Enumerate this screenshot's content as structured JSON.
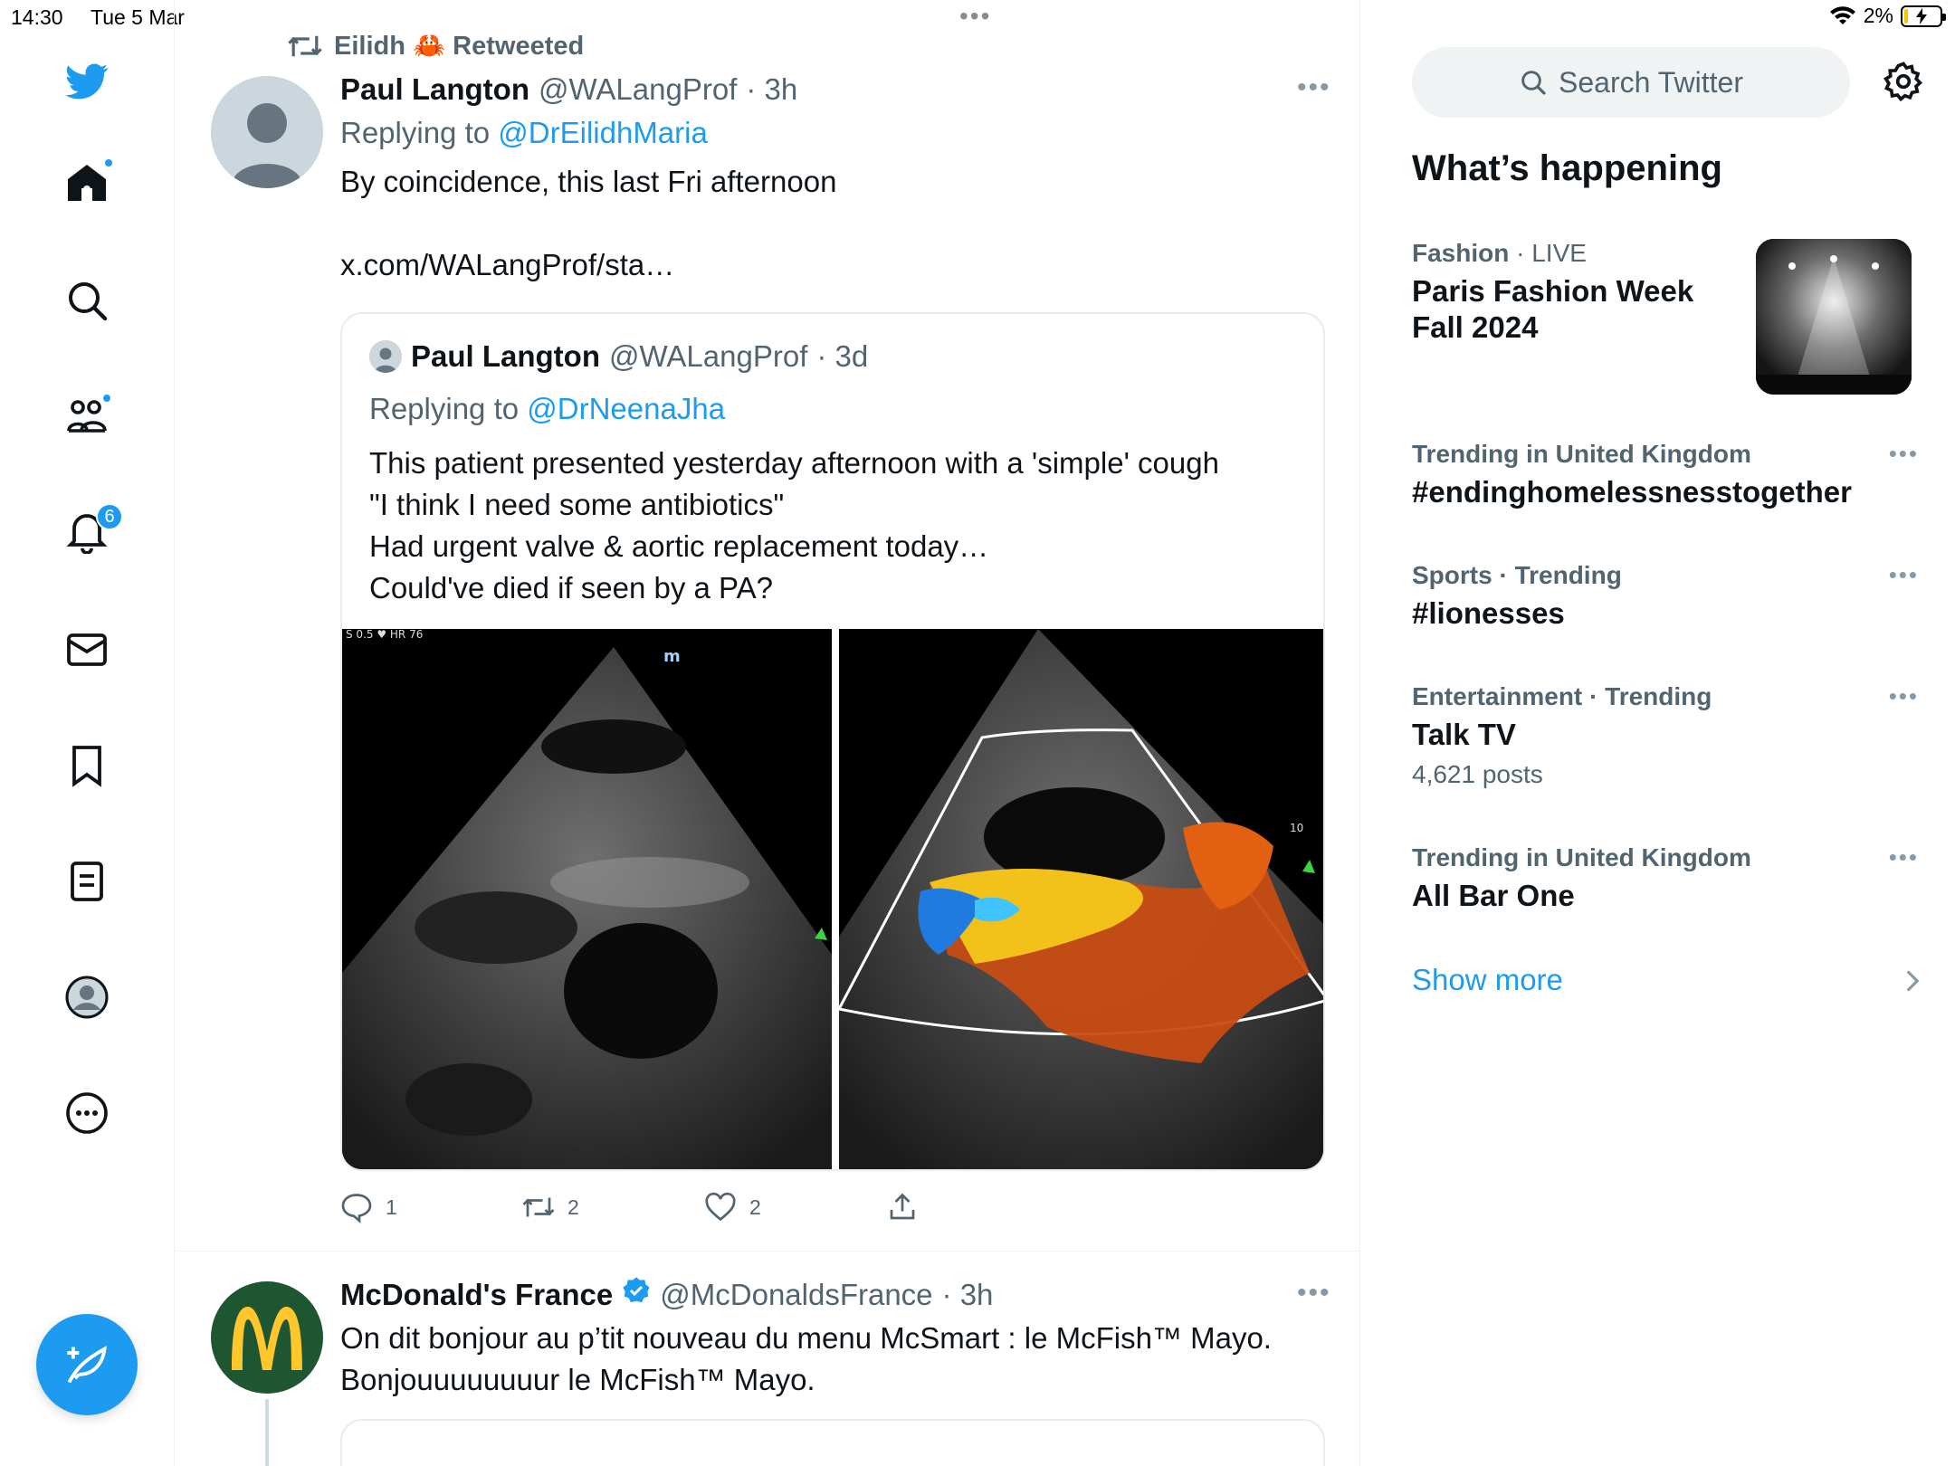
{
  "status_bar": {
    "time": "14:30",
    "date": "Tue 5 Mar",
    "multitask": "•••",
    "battery": "2%"
  },
  "nav": {
    "notifications_badge": "6",
    "items": [
      "home-icon",
      "search-icon",
      "communities-icon",
      "notifications-icon",
      "messages-icon",
      "bookmarks-icon",
      "lists-icon",
      "profile-icon",
      "more-icon"
    ]
  },
  "tweet1": {
    "retweeted_by": "Eilidh 🦀 Retweeted",
    "name": "Paul Langton",
    "handle": "@WALangProf",
    "time": "· 3h",
    "replying_label": "Replying to",
    "replying_to": "@DrEilidhMaria",
    "text": "By coincidence, this last Fri afternoon",
    "link": "x.com/WALangProf/sta…",
    "quote": {
      "name": "Paul Langton",
      "handle": "@WALangProf",
      "time": "· 3d",
      "replying_label": "Replying to",
      "replying_to": "@DrNeenaJha",
      "lines": [
        "This patient presented yesterday afternoon with a 'simple' cough",
        "\"I think I need some antibiotics\"",
        "Had urgent valve & aortic replacement today…",
        "Could've died if seen by a PA?"
      ],
      "image_label_left": "S 0.5 ♥ HR 76"
    },
    "actions": {
      "replies": "1",
      "retweets": "2",
      "likes": "2"
    }
  },
  "tweet2": {
    "name": "McDonald's France",
    "handle": "@McDonaldsFrance",
    "time": "· 3h",
    "line1": "On dit bonjour au p’tit nouveau du menu McSmart : le McFish™ Mayo.",
    "line2": "Bonjouuuuuuuur le McFish™ Mayo."
  },
  "sidebar": {
    "search_placeholder": "Search Twitter",
    "whats_happening": "What’s happening",
    "trends": [
      {
        "category": "Fashion",
        "context": "· LIVE",
        "title_line1": "Paris Fashion Week",
        "title_line2": "Fall 2024"
      },
      {
        "category": "Trending in United Kingdom",
        "context": "",
        "title": "#endinghomelessnesstogether"
      },
      {
        "category": "Sports",
        "context": "· Trending",
        "title": "#lionesses"
      },
      {
        "category": "Entertainment",
        "context": "· Trending",
        "title": "Talk TV",
        "posts": "4,621 posts"
      },
      {
        "category": "Trending in United Kingdom",
        "context": "",
        "title": "All Bar One"
      }
    ],
    "show_more": "Show more"
  },
  "colors": {
    "accent": "#1d9bf0",
    "text": "#0f1419",
    "secondary": "#536471",
    "mcd_green": "#1e5631",
    "mcd_yellow": "#ffc72c"
  }
}
